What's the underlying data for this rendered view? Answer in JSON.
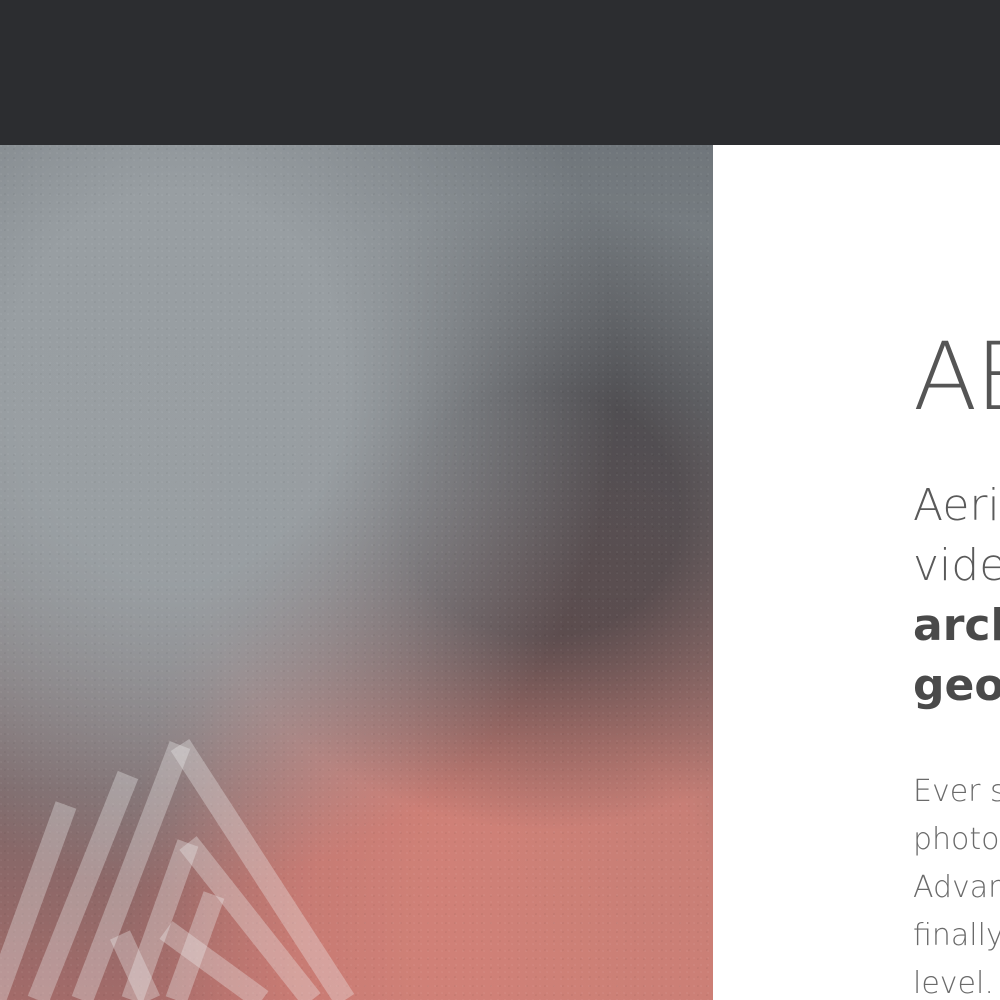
{
  "header": {
    "background_color": "#2c2d30"
  },
  "hero": {
    "logo_icon": "a-line-logo-icon"
  },
  "about": {
    "heading": "AB",
    "lead_lines": [
      "Aeria",
      "vide",
      "arch",
      "geo"
    ],
    "body_lines": [
      "Ever s",
      "photo",
      "Advan",
      "finally",
      "level. I"
    ]
  }
}
